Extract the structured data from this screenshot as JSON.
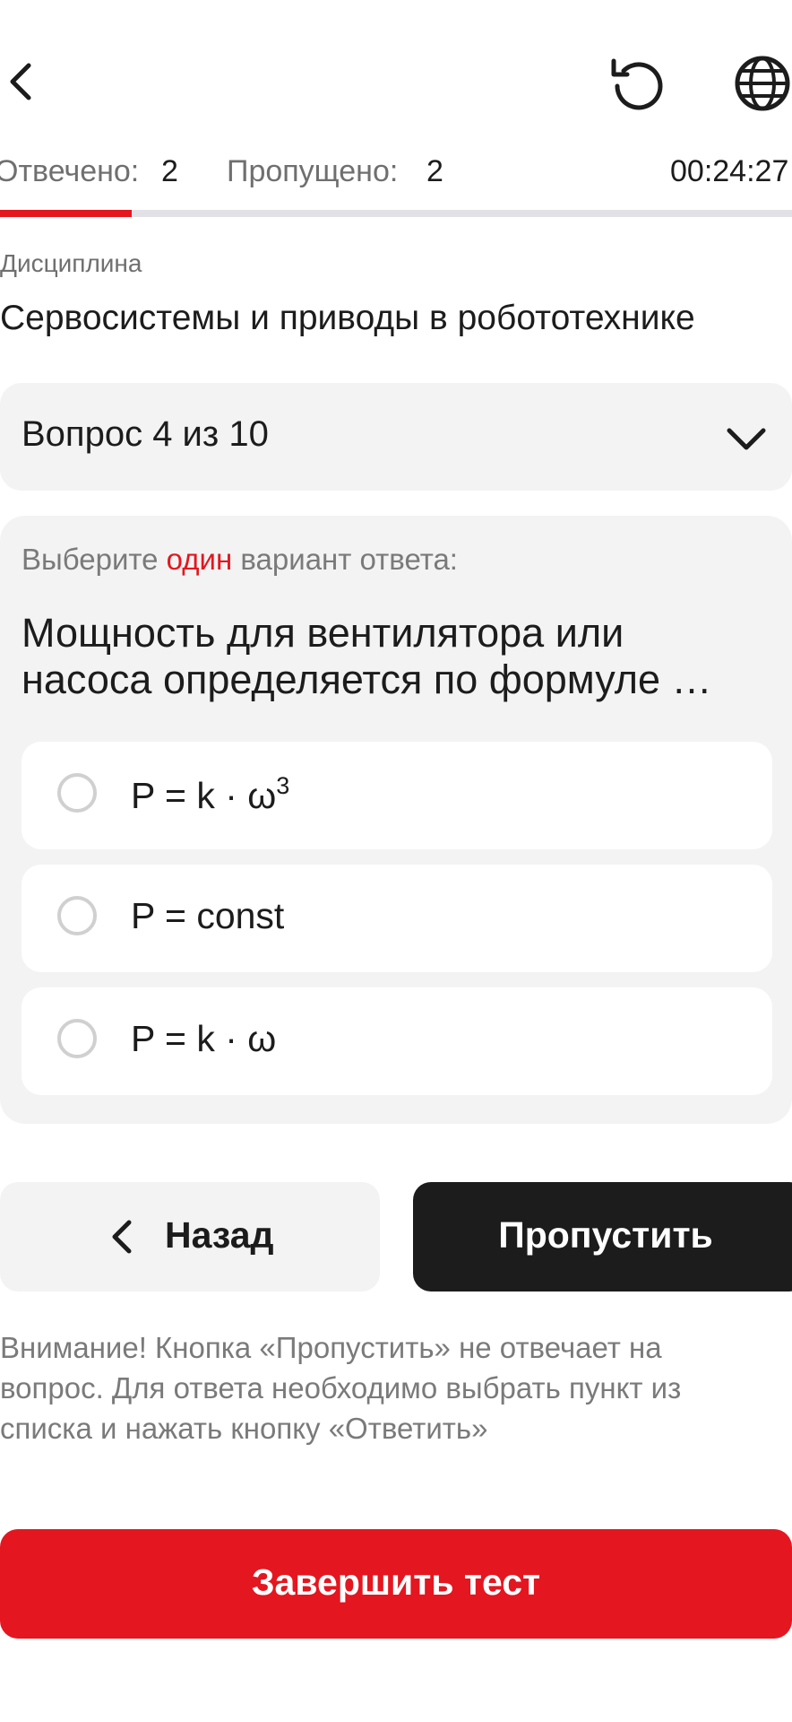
{
  "header": {
    "back_icon": "chevron-left-icon",
    "refresh_icon": "refresh-icon",
    "language_icon": "globe-icon"
  },
  "stats": {
    "answered_label": "Отвечено:",
    "answered_value": "2",
    "skipped_label": "Пропущено:",
    "skipped_value": "2",
    "timer": "00:24:27"
  },
  "progress": {
    "fraction": 0.166,
    "accent_color": "#e4161f",
    "track_color": "#e2e2e6"
  },
  "discipline": {
    "caption": "Дисциплина",
    "name": "Сервосистемы и приводы в робототехнике"
  },
  "question_selector": {
    "label": "Вопрос 4 из 10",
    "icon": "chevron-down-icon"
  },
  "question": {
    "hint_prefix": "Выберите",
    "hint_accent": "один",
    "hint_suffix": "вариант ответа:",
    "text": "Мощность для вентилятора или насоса определяется по формуле …",
    "options": [
      {
        "text": "P = k · ω",
        "sup": "3"
      },
      {
        "text": "P = const",
        "sup": ""
      },
      {
        "text": "P = k · ω",
        "sup": ""
      }
    ]
  },
  "actions": {
    "back_label": "Назад",
    "skip_label": "Пропустить",
    "warning": "Внимание! Кнопка «Пропустить» не отвечает на вопрос. Для ответа необходимо выбрать пункт из списка и нажать кнопку «Ответить»",
    "finish_label": "Завершить тест"
  },
  "colors": {
    "accent": "#e4161f",
    "dark_button": "#1c1c1c",
    "card_bg": "#f3f3f3"
  }
}
